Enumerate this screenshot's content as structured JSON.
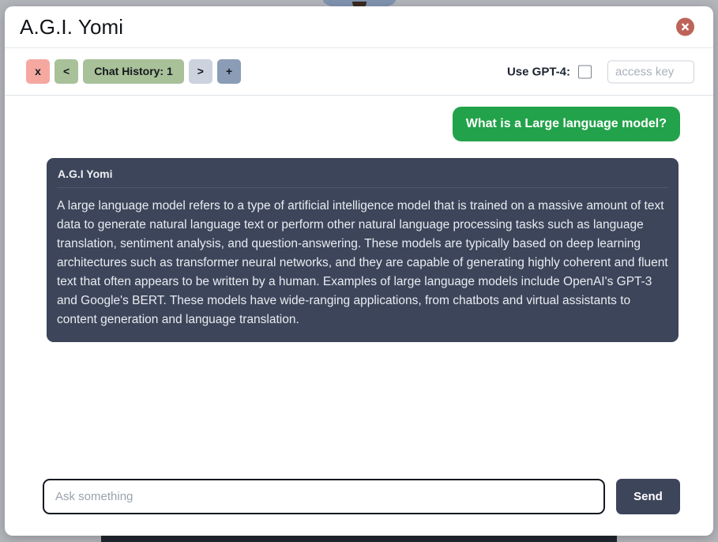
{
  "window": {
    "title": "A.G.I. Yomi",
    "close_icon": "close-circle-icon"
  },
  "toolbar": {
    "clear_label": "x",
    "prev_label": "<",
    "history_label": "Chat History: 1",
    "next_label": ">",
    "add_label": "+",
    "gpt4_label": "Use GPT-4:",
    "gpt4_checked": false,
    "access_key_value": "",
    "access_key_placeholder": "access key",
    "colors": {
      "clear": "#f4a8a0",
      "prev": "#a9c199",
      "history": "#a9c199",
      "next": "#ccd2de",
      "add": "#8b9cb6"
    }
  },
  "chat": {
    "messages": [
      {
        "role": "user",
        "text": "What is a Large language model?"
      },
      {
        "role": "assistant",
        "name": "A.G.I Yomi",
        "text": "A large language model refers to a type of artificial intelligence model that is trained on a massive amount of text data to generate natural language text or perform other natural language processing tasks such as language translation, sentiment analysis, and question-answering. These models are typically based on deep learning architectures such as transformer neural networks, and they are capable of generating highly coherent and fluent text that often appears to be written by a human. Examples of large language models include OpenAI's GPT-3 and Google's BERT. These models have wide-ranging applications, from chatbots and virtual assistants to content generation and language translation."
      }
    ]
  },
  "composer": {
    "input_value": "",
    "input_placeholder": "Ask something",
    "send_label": "Send"
  },
  "theme": {
    "accent_user_bubble": "#22a24a",
    "assistant_bubble": "#3c4559",
    "close_button": "#bd6459",
    "page_background": "#b2b5ba"
  }
}
